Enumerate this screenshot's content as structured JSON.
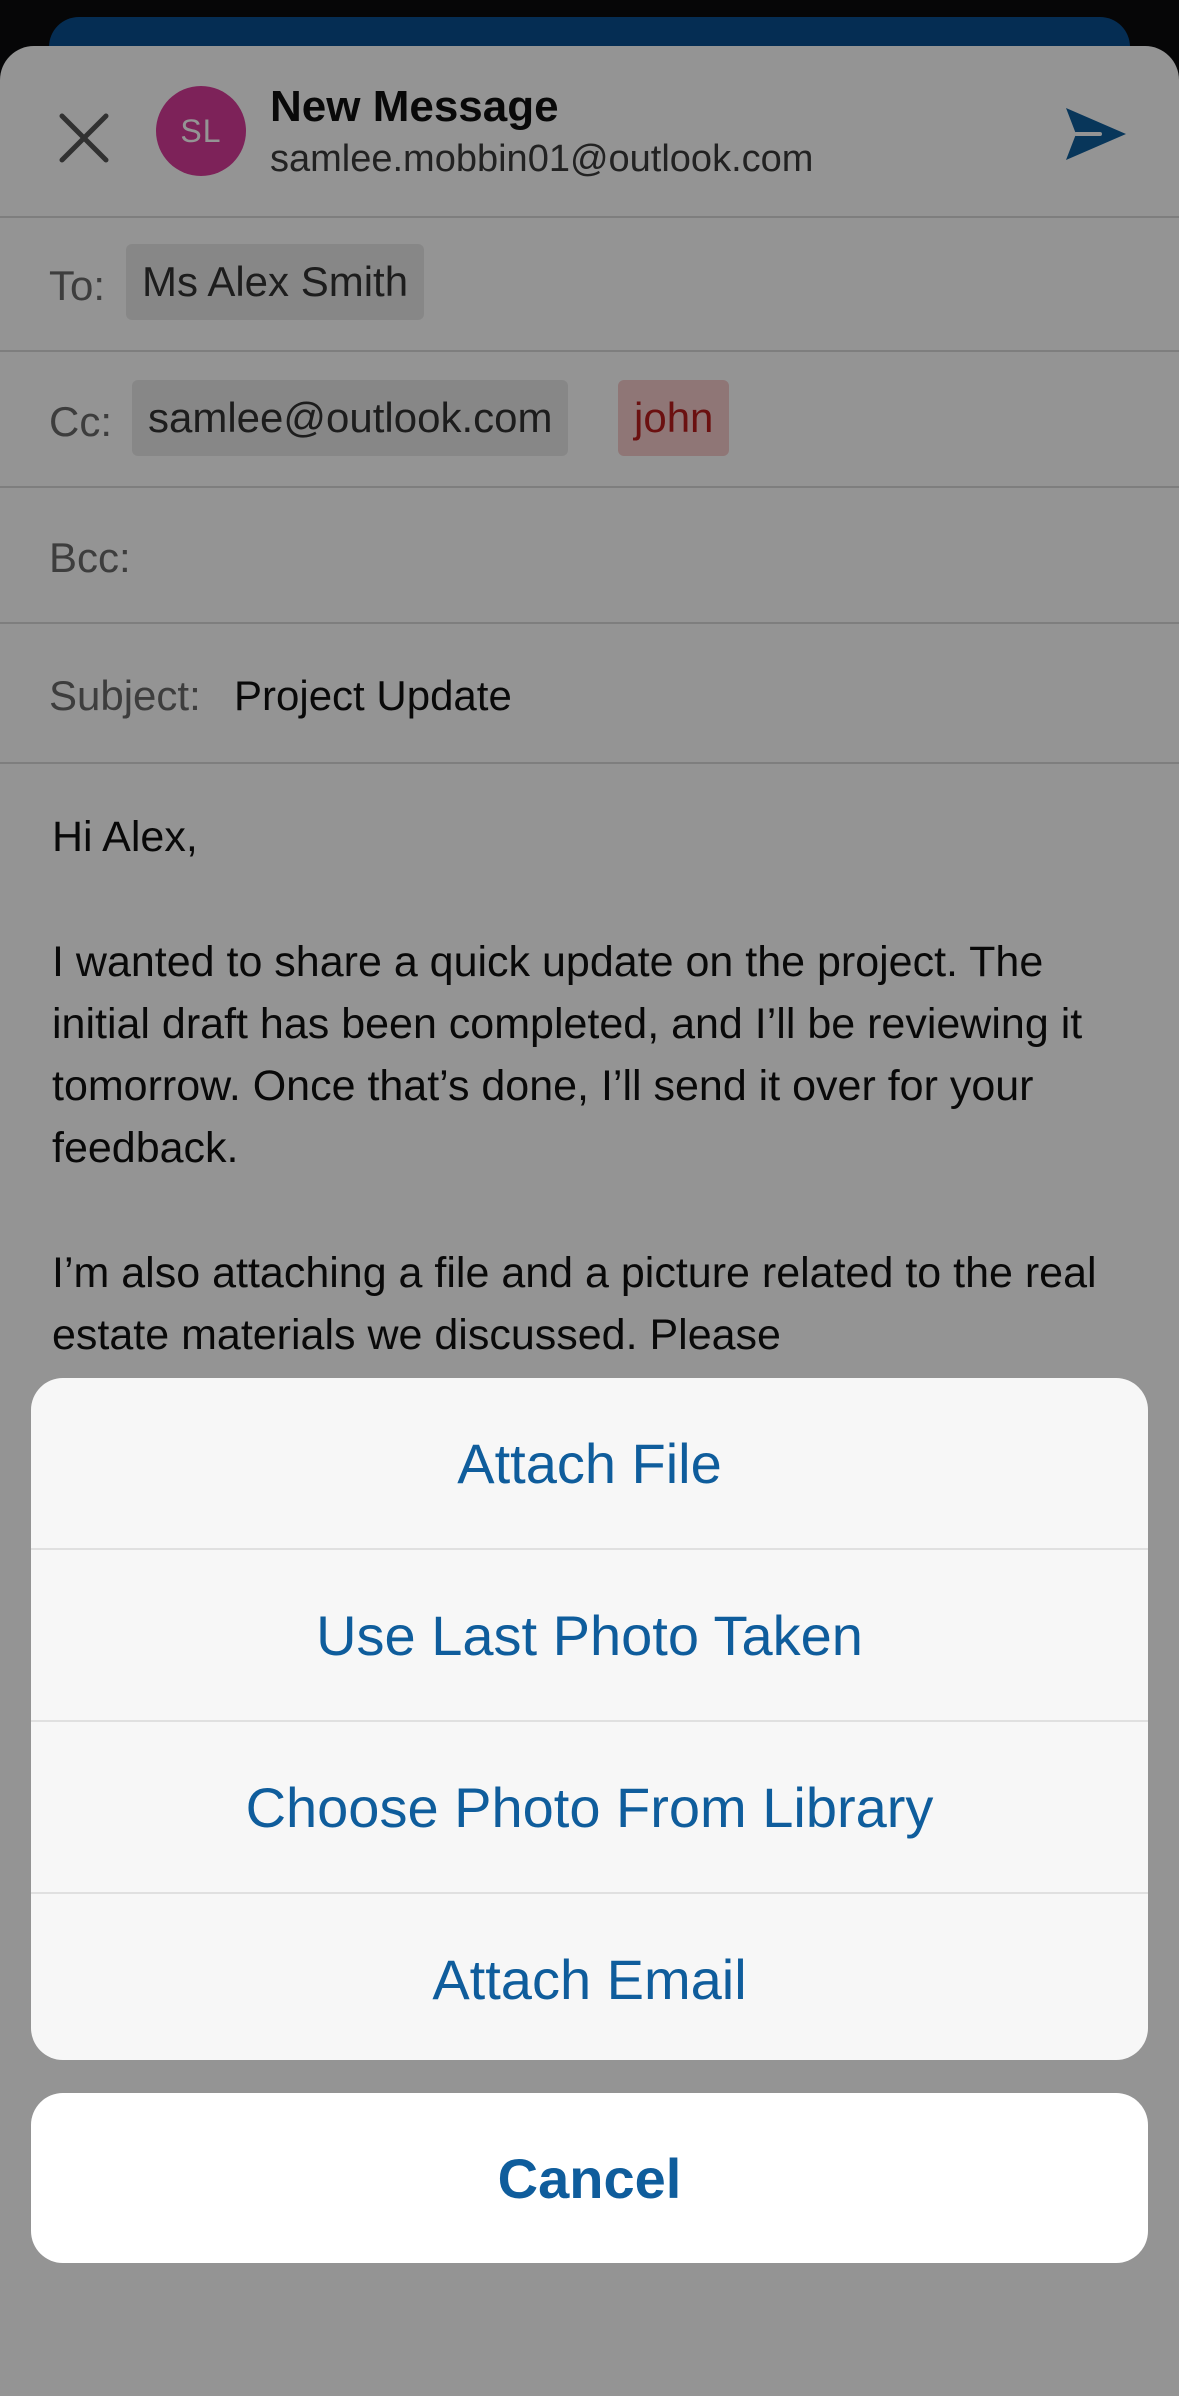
{
  "compose": {
    "title": "New Message",
    "from_address": "samlee.mobbin01@outlook.com",
    "avatar_initials": "SL",
    "avatar_color": "#d83c99",
    "to_label": "To:",
    "to_recipients": [
      "Ms Alex Smith"
    ],
    "cc_label": "Cc:",
    "cc_recipients": [
      "samlee@outlook.com",
      "john"
    ],
    "bcc_label": "Bcc:",
    "subject_label": "Subject:",
    "subject_value": "Project Update",
    "body_paragraphs": [
      "Hi Alex,",
      "I wanted to share a quick update on the project. The initial draft has been completed, and I’ll be reviewing it tomorrow. Once that’s done, I’ll send it over for your feedback.",
      "I’m also attaching a file and a picture related to the real estate materials we discussed. Please"
    ],
    "icons": {
      "close": "close-icon",
      "send": "send-icon"
    },
    "accent_color": "#0f5d9c"
  },
  "action_sheet": {
    "items": [
      "Attach File",
      "Use Last Photo Taken",
      "Choose Photo From Library",
      "Attach Email"
    ],
    "cancel_label": "Cancel"
  }
}
